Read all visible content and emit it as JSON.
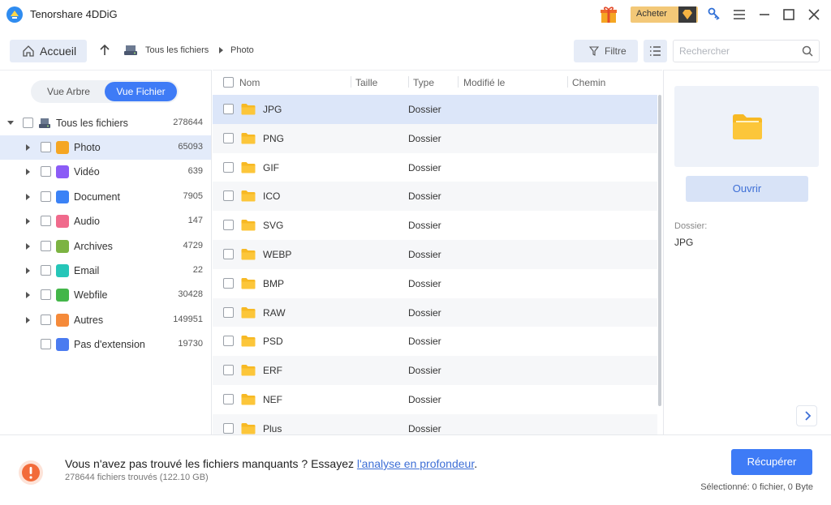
{
  "app": {
    "title": "Tenorshare 4DDiG"
  },
  "titlebar": {
    "buy_label": "Acheter"
  },
  "toolbar": {
    "home_label": "Accueil",
    "breadcrumb": [
      "Tous les fichiers",
      "Photo"
    ],
    "filter_label": "Filtre",
    "search_placeholder": "Rechercher"
  },
  "view_toggle": {
    "tree": "Vue Arbre",
    "file": "Vue Fichier",
    "active": "file"
  },
  "tree": {
    "root": {
      "label": "Tous les fichiers",
      "count": "278644"
    },
    "items": [
      {
        "label": "Photo",
        "count": "65093",
        "icon": "photo-icon",
        "color": "#f5a623"
      },
      {
        "label": "Vidéo",
        "count": "639",
        "icon": "video-icon",
        "color": "#8b5cf6"
      },
      {
        "label": "Document",
        "count": "7905",
        "icon": "document-icon",
        "color": "#3b82f6"
      },
      {
        "label": "Audio",
        "count": "147",
        "icon": "audio-icon",
        "color": "#f06a8c"
      },
      {
        "label": "Archives",
        "count": "4729",
        "icon": "archive-icon",
        "color": "#7cb342"
      },
      {
        "label": "Email",
        "count": "22",
        "icon": "email-icon",
        "color": "#26c6b8"
      },
      {
        "label": "Webfile",
        "count": "30428",
        "icon": "webfile-icon",
        "color": "#43b649"
      },
      {
        "label": "Autres",
        "count": "149951",
        "icon": "others-icon",
        "color": "#f58a3a"
      },
      {
        "label": "Pas d'extension",
        "count": "19730",
        "icon": "unknown-icon",
        "color": "#4a7bf0"
      }
    ]
  },
  "file_list": {
    "columns": [
      "Nom",
      "Taille",
      "Type",
      "Modifié le",
      "Chemin"
    ],
    "rows": [
      {
        "name": "JPG",
        "type": "Dossier"
      },
      {
        "name": "PNG",
        "type": "Dossier"
      },
      {
        "name": "GIF",
        "type": "Dossier"
      },
      {
        "name": "ICO",
        "type": "Dossier"
      },
      {
        "name": "SVG",
        "type": "Dossier"
      },
      {
        "name": "WEBP",
        "type": "Dossier"
      },
      {
        "name": "BMP",
        "type": "Dossier"
      },
      {
        "name": "RAW",
        "type": "Dossier"
      },
      {
        "name": "PSD",
        "type": "Dossier"
      },
      {
        "name": "ERF",
        "type": "Dossier"
      },
      {
        "name": "NEF",
        "type": "Dossier"
      },
      {
        "name": "Plus",
        "type": "Dossier"
      }
    ]
  },
  "preview": {
    "open_label": "Ouvrir",
    "info_label": "Dossier:",
    "info_value": "JPG"
  },
  "bottom": {
    "message_prefix": "Vous n'avez pas trouvé les fichiers manquants ? Essayez ",
    "link_text": "l'analyse en profondeur",
    "message_suffix": ".",
    "found_count": "278644 fichiers trouvés (122.10 GB)",
    "recover_label": "Récupérer",
    "selected_info": "Sélectionné: 0 fichier, 0 Byte"
  },
  "colors": {
    "accent": "#3e7bf6",
    "folder": "#f7b924",
    "warning": "#f26b3a"
  }
}
